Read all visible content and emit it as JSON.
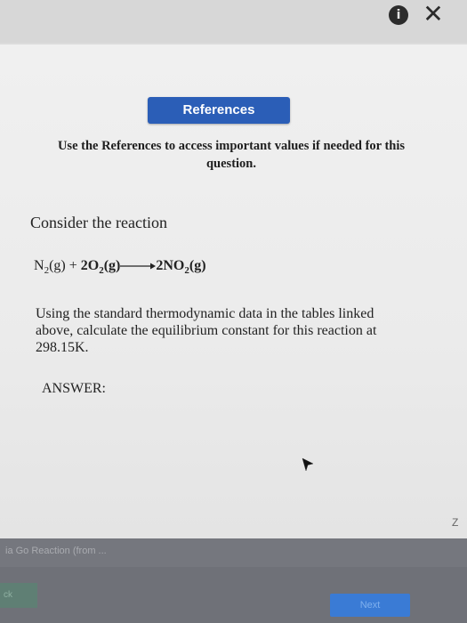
{
  "window": {
    "info_icon_glyph": "i",
    "close_icon_glyph": "✕"
  },
  "references": {
    "button_label": "References",
    "note": "Use the References to access important values if needed for this question."
  },
  "problem": {
    "intro": "Consider the reaction",
    "reaction": {
      "reactant1": "N",
      "reactant1_sub": "2",
      "reactant1_state": "(g)",
      "plus": "+",
      "reactant2_coef": "2O",
      "reactant2_sub": "2",
      "reactant2_state": "(g)",
      "product_coef": "2NO",
      "product_sub": "2",
      "product_state": "(g)"
    },
    "question": "Using the standard thermodynamic data in the tables linked above, calculate the equilibrium constant for this reaction at 298.15K.",
    "answer_label": "ANSWER:"
  },
  "side_letter": "Z",
  "footer": {
    "title": "ia Go Reaction (from ...",
    "back_label": "ck",
    "next_label": "Next"
  },
  "colors": {
    "accent": "#2b5eb7",
    "footer": "#6f7178"
  }
}
